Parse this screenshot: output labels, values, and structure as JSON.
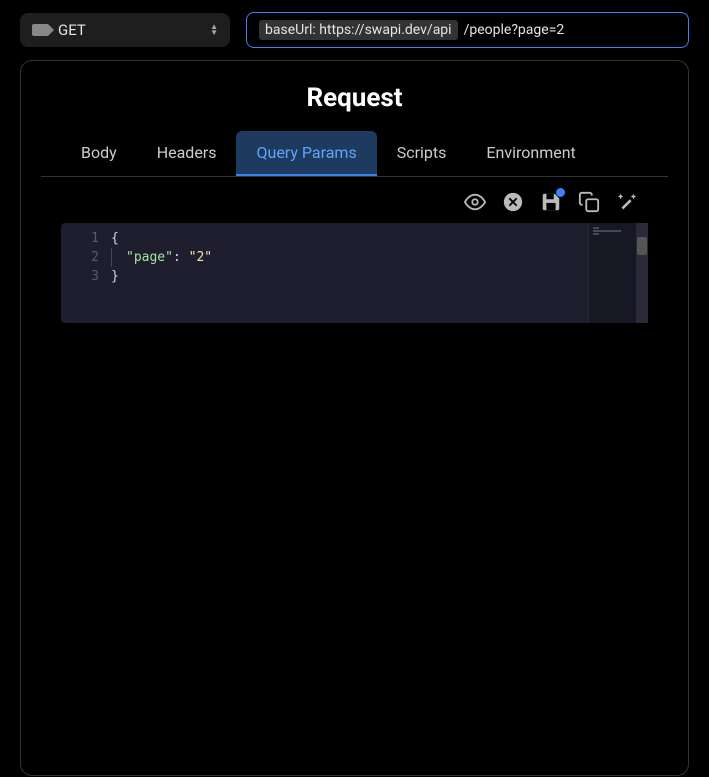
{
  "method": "GET",
  "url": {
    "base_label": "baseUrl: https://swapi.dev/api",
    "path": "/people?page=2"
  },
  "panel_title": "Request",
  "tabs": [
    {
      "label": "Body",
      "active": false
    },
    {
      "label": "Headers",
      "active": false
    },
    {
      "label": "Query Params",
      "active": true
    },
    {
      "label": "Scripts",
      "active": false
    },
    {
      "label": "Environment",
      "active": false
    }
  ],
  "editor": {
    "lines": [
      "1",
      "2",
      "3"
    ],
    "content": {
      "key": "\"page\"",
      "value": "\"2\""
    },
    "raw": "{\n  \"page\": \"2\"\n}"
  },
  "unsaved_changes": true
}
